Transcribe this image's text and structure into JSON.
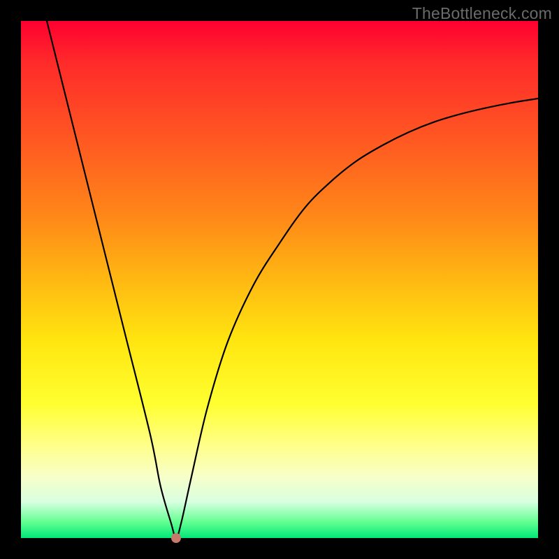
{
  "watermark": "TheBottleneck.com",
  "chart_data": {
    "type": "line",
    "title": "",
    "xlabel": "",
    "ylabel": "",
    "xlim": [
      0,
      100
    ],
    "ylim": [
      0,
      100
    ],
    "grid": false,
    "series": [
      {
        "name": "curve",
        "x": [
          5,
          10,
          15,
          20,
          25,
          27,
          29,
          30,
          31,
          33,
          36,
          40,
          45,
          50,
          55,
          60,
          65,
          70,
          75,
          80,
          85,
          90,
          95,
          100
        ],
        "y": [
          100,
          80,
          60,
          40,
          20,
          10,
          3,
          0,
          3,
          12,
          25,
          38,
          49,
          57,
          64,
          69,
          73,
          76,
          78.5,
          80.5,
          82,
          83.2,
          84.2,
          85
        ]
      }
    ],
    "marker": {
      "x": 30,
      "y": 0,
      "color": "#c77a6a"
    },
    "background_gradient": [
      "#ff0030",
      "#ffb812",
      "#ffff30",
      "#00e878"
    ]
  }
}
